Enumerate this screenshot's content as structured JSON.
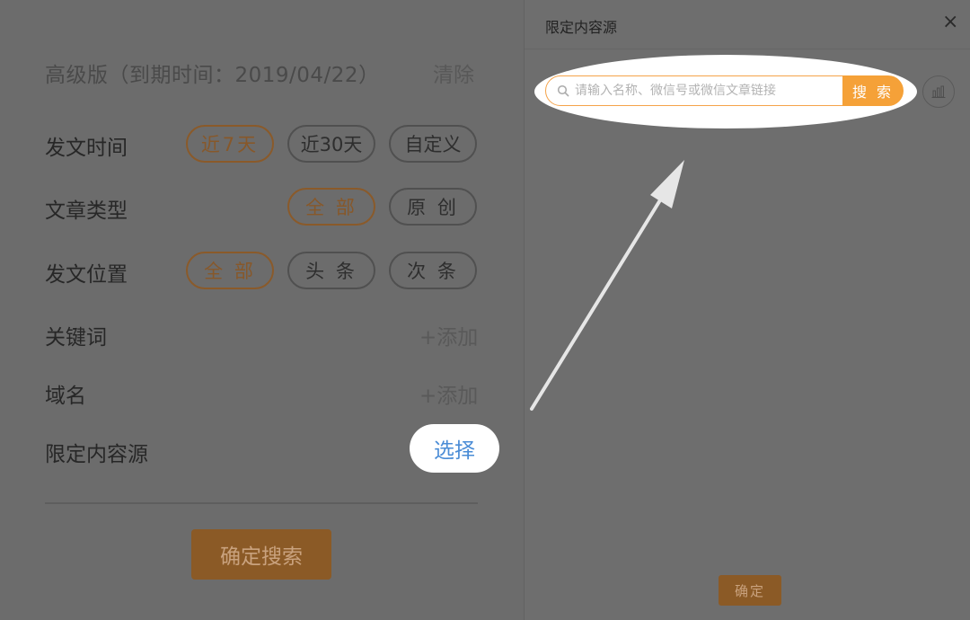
{
  "left": {
    "edition": "高级版（到期时间：2019/04/22）",
    "clear": "清除",
    "publish_time": {
      "label": "发文时间",
      "options": [
        "近7天",
        "近30天",
        "自定义"
      ],
      "selected": "近7天"
    },
    "article_type": {
      "label": "文章类型",
      "options": [
        "全 部",
        "原 创"
      ],
      "selected": "全 部"
    },
    "publish_position": {
      "label": "发文位置",
      "options": [
        "全 部",
        "头 条",
        "次 条"
      ],
      "selected": "全 部"
    },
    "keyword": {
      "label": "关键词",
      "action": "+添加"
    },
    "domain": {
      "label": "域名",
      "action": "+添加"
    },
    "content_source": {
      "label": "限定内容源",
      "action": "选择"
    },
    "confirm_search": "确定搜索"
  },
  "right": {
    "title": "限定内容源",
    "close": "×",
    "search_placeholder": "请输入名称、微信号或微信文章链接",
    "search_button": "搜 索",
    "confirm": "确定"
  },
  "colors": {
    "accent": "#f5a138",
    "link": "#4a8cd6",
    "overlay": "#6b6b6b"
  },
  "icons": [
    "search-icon",
    "bar-chart-icon",
    "close-icon",
    "arrow-annotation"
  ]
}
